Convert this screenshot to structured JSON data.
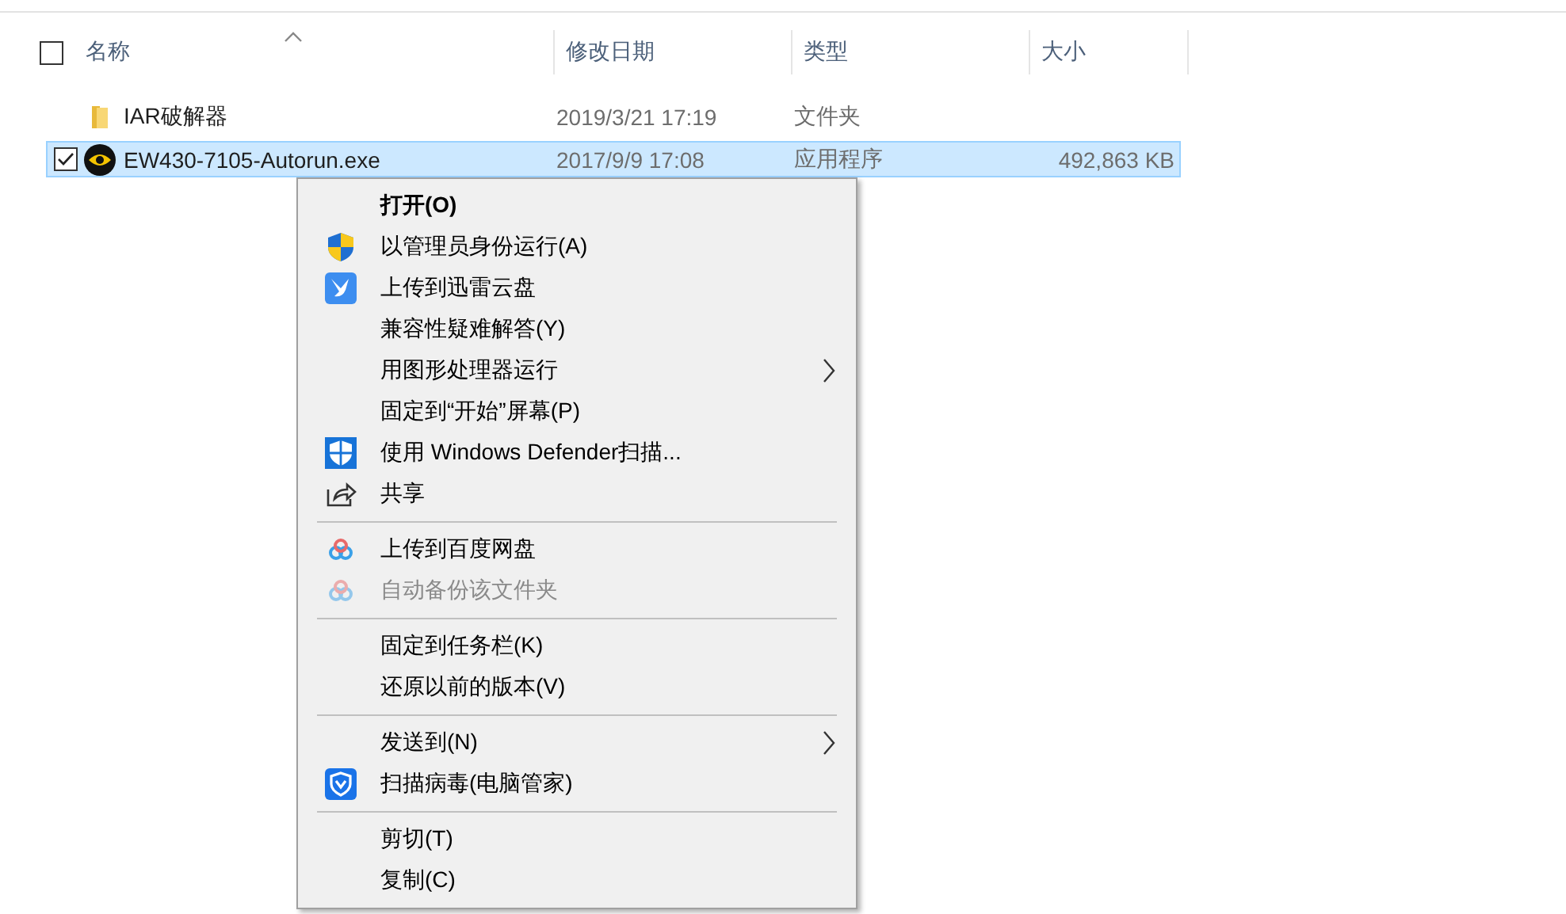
{
  "file_list": {
    "columns": [
      {
        "label": "名称",
        "sorted": true
      },
      {
        "label": "修改日期",
        "sorted": false
      },
      {
        "label": "类型",
        "sorted": false
      },
      {
        "label": "大小",
        "sorted": false
      }
    ],
    "header_checked": false,
    "rows": [
      {
        "kind": "folder",
        "name": "IAR破解器",
        "modified": "2019/3/21 17:19",
        "type": "文件夹",
        "size": "",
        "selected": false
      },
      {
        "kind": "application",
        "name": "EW430-7105-Autorun.exe",
        "modified": "2017/9/9 17:08",
        "type": "应用程序",
        "size": "492,863 KB",
        "selected": true
      }
    ]
  },
  "context_menu": {
    "groups": [
      [
        {
          "label": "打开(O)",
          "default": true,
          "disabled": false,
          "submenu": false
        },
        {
          "label": "以管理员身份运行(A)",
          "default": false,
          "disabled": false,
          "submenu": false
        },
        {
          "label": "上传到迅雷云盘",
          "default": false,
          "disabled": false,
          "submenu": false
        },
        {
          "label": "兼容性疑难解答(Y)",
          "default": false,
          "disabled": false,
          "submenu": false
        },
        {
          "label": "用图形处理器运行",
          "default": false,
          "disabled": false,
          "submenu": true
        },
        {
          "label": "固定到“开始”屏幕(P)",
          "default": false,
          "disabled": false,
          "submenu": false
        },
        {
          "label": "使用 Windows Defender扫描...",
          "default": false,
          "disabled": false,
          "submenu": false
        },
        {
          "label": "共享",
          "default": false,
          "disabled": false,
          "submenu": false
        }
      ],
      [
        {
          "label": "上传到百度网盘",
          "default": false,
          "disabled": false,
          "submenu": false
        },
        {
          "label": "自动备份该文件夹",
          "default": false,
          "disabled": true,
          "submenu": false
        }
      ],
      [
        {
          "label": "固定到任务栏(K)",
          "default": false,
          "disabled": false,
          "submenu": false
        },
        {
          "label": "还原以前的版本(V)",
          "default": false,
          "disabled": false,
          "submenu": false
        }
      ],
      [
        {
          "label": "发送到(N)",
          "default": false,
          "disabled": false,
          "submenu": true
        },
        {
          "label": "扫描病毒(电脑管家)",
          "default": false,
          "disabled": false,
          "submenu": false
        }
      ],
      [
        {
          "label": "剪切(T)",
          "default": false,
          "disabled": false,
          "submenu": false
        },
        {
          "label": "复制(C)",
          "default": false,
          "disabled": false,
          "submenu": false
        }
      ]
    ]
  }
}
